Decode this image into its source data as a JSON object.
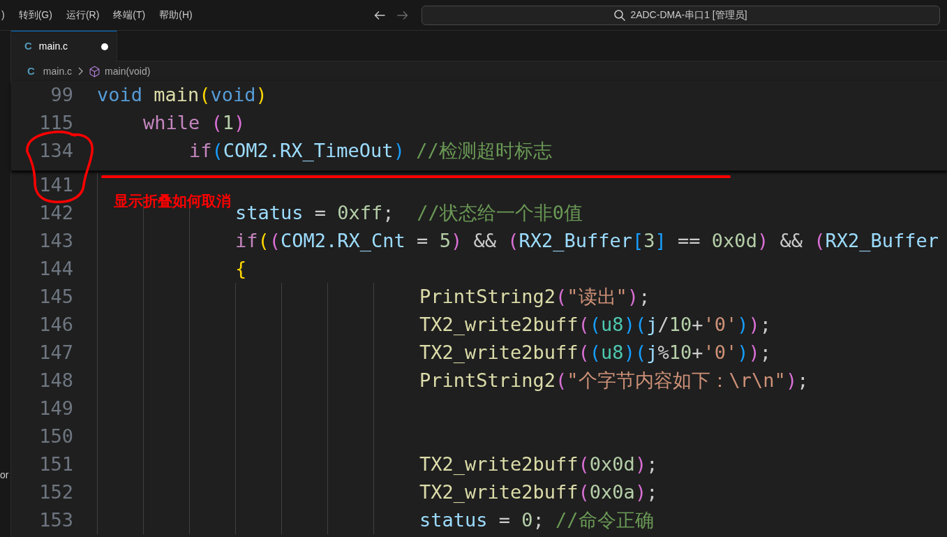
{
  "menu": [
    ")",
    "转到(G)",
    "运行(R)",
    "终端(T)",
    "帮助(H)"
  ],
  "nav": [
    {
      "kind": "back",
      "disabled": false
    },
    {
      "kind": "forward",
      "disabled": true
    }
  ],
  "command_center": {
    "title": "2ADC-DMA-串口1 [管理员]"
  },
  "sidebar": {
    "text": "or"
  },
  "tabs": [
    {
      "icon": "C",
      "label": "main.c",
      "selected": true,
      "modified": true
    }
  ],
  "breadcrumb": [
    {
      "kind": "file",
      "icon": "C",
      "label": "main.c"
    },
    {
      "kind": "symbol",
      "label": "main(void)"
    }
  ],
  "editor": {
    "sticky_scroll": [
      {
        "number": "99",
        "tokens": [
          {
            "text": "void",
            "kind": "keyword"
          },
          {
            "text": " main",
            "kind": "function"
          },
          {
            "text": "(",
            "kind": "bracket1"
          },
          {
            "text": "void",
            "kind": "keyword"
          },
          {
            "text": ")",
            "kind": "bracket1"
          }
        ]
      },
      {
        "number": "115",
        "tokens": [
          {
            "text": "while",
            "kind": "control"
          },
          {
            "text": " (",
            "kind": "bracket2"
          },
          {
            "text": "1",
            "kind": "number"
          },
          {
            "text": ")",
            "kind": "bracket2"
          }
        ]
      },
      {
        "number": "134",
        "tokens": [
          {
            "text": "if",
            "kind": "control"
          },
          {
            "text": "(",
            "kind": "bracket3"
          },
          {
            "text": "COM2.RX_TimeOut",
            "kind": "variable"
          },
          {
            "text": ")",
            "kind": "bracket3"
          },
          {
            "text": " //检测超时标志",
            "kind": "comment"
          }
        ]
      }
    ],
    "lines": [
      {
        "number": "141"
      },
      {
        "number": "142",
        "tokens": [
          {
            "text": "status",
            "kind": "variable"
          },
          {
            "text": " = ",
            "kind": "plain"
          },
          {
            "text": "0xff",
            "kind": "number"
          },
          {
            "text": ";",
            "kind": "plain"
          },
          {
            "text": "  //状态给一个非0值",
            "kind": "comment"
          }
        ]
      },
      {
        "number": "143",
        "tokens": [
          {
            "text": "if",
            "kind": "control"
          },
          {
            "text": "(",
            "kind": "bracket1"
          },
          {
            "text": "(",
            "kind": "bracket2"
          },
          {
            "text": "COM2.RX_Cnt",
            "kind": "variable"
          },
          {
            "text": " = ",
            "kind": "plain"
          },
          {
            "text": "5",
            "kind": "number"
          },
          {
            "text": ")",
            "kind": "bracket2"
          },
          {
            "text": " && ",
            "kind": "plain"
          },
          {
            "text": "(",
            "kind": "bracket2"
          },
          {
            "text": "RX2_Buffer",
            "kind": "variable"
          },
          {
            "text": "[",
            "kind": "bracket3"
          },
          {
            "text": "3",
            "kind": "number"
          },
          {
            "text": "]",
            "kind": "bracket3"
          },
          {
            "text": " == ",
            "kind": "plain"
          },
          {
            "text": "0x0d",
            "kind": "number"
          },
          {
            "text": ")",
            "kind": "bracket2"
          },
          {
            "text": " && ",
            "kind": "plain"
          },
          {
            "text": "(",
            "kind": "bracket2"
          },
          {
            "text": "RX2_Buffer",
            "kind": "variable"
          }
        ]
      },
      {
        "number": "144",
        "tokens": [
          {
            "text": "{",
            "kind": "bracket1"
          }
        ]
      },
      {
        "number": "145",
        "tokens": [
          {
            "text": "PrintString2",
            "kind": "function"
          },
          {
            "text": "(",
            "kind": "bracket2"
          },
          {
            "text": "\"读出\"",
            "kind": "string"
          },
          {
            "text": ")",
            "kind": "bracket2"
          },
          {
            "text": ";",
            "kind": "plain"
          }
        ]
      },
      {
        "number": "146",
        "tokens": [
          {
            "text": "TX2_write2buff",
            "kind": "function"
          },
          {
            "text": "(",
            "kind": "bracket2"
          },
          {
            "text": "(",
            "kind": "bracket3"
          },
          {
            "text": "u8",
            "kind": "type"
          },
          {
            "text": ")",
            "kind": "bracket3"
          },
          {
            "text": "(",
            "kind": "bracket3"
          },
          {
            "text": "j",
            "kind": "variable"
          },
          {
            "text": "/",
            "kind": "plain"
          },
          {
            "text": "10",
            "kind": "number"
          },
          {
            "text": "+",
            "kind": "plain"
          },
          {
            "text": "'0'",
            "kind": "string"
          },
          {
            "text": ")",
            "kind": "bracket3"
          },
          {
            "text": ")",
            "kind": "bracket2"
          },
          {
            "text": ";",
            "kind": "plain"
          }
        ]
      },
      {
        "number": "147",
        "tokens": [
          {
            "text": "TX2_write2buff",
            "kind": "function"
          },
          {
            "text": "(",
            "kind": "bracket2"
          },
          {
            "text": "(",
            "kind": "bracket3"
          },
          {
            "text": "u8",
            "kind": "type"
          },
          {
            "text": ")",
            "kind": "bracket3"
          },
          {
            "text": "(",
            "kind": "bracket3"
          },
          {
            "text": "j",
            "kind": "variable"
          },
          {
            "text": "%",
            "kind": "plain"
          },
          {
            "text": "10",
            "kind": "number"
          },
          {
            "text": "+",
            "kind": "plain"
          },
          {
            "text": "'0'",
            "kind": "string"
          },
          {
            "text": ")",
            "kind": "bracket3"
          },
          {
            "text": ")",
            "kind": "bracket2"
          },
          {
            "text": ";",
            "kind": "plain"
          }
        ]
      },
      {
        "number": "148",
        "tokens": [
          {
            "text": "PrintString2",
            "kind": "function"
          },
          {
            "text": "(",
            "kind": "bracket2"
          },
          {
            "text": "\"个字节内容如下：\\r\\n\"",
            "kind": "string"
          },
          {
            "text": ")",
            "kind": "bracket2"
          },
          {
            "text": ";",
            "kind": "plain"
          }
        ]
      },
      {
        "number": "149"
      },
      {
        "number": "150"
      },
      {
        "number": "151",
        "tokens": [
          {
            "text": "TX2_write2buff",
            "kind": "function"
          },
          {
            "text": "(",
            "kind": "bracket2"
          },
          {
            "text": "0x0d",
            "kind": "number"
          },
          {
            "text": ")",
            "kind": "bracket2"
          },
          {
            "text": ";",
            "kind": "plain"
          }
        ]
      },
      {
        "number": "152",
        "tokens": [
          {
            "text": "TX2_write2buff",
            "kind": "function"
          },
          {
            "text": "(",
            "kind": "bracket2"
          },
          {
            "text": "0x0a",
            "kind": "number"
          },
          {
            "text": ")",
            "kind": "bracket2"
          },
          {
            "text": ";",
            "kind": "plain"
          }
        ]
      },
      {
        "number": "153",
        "tokens": [
          {
            "text": "status",
            "kind": "variable"
          },
          {
            "text": " = ",
            "kind": "plain"
          },
          {
            "text": "0",
            "kind": "number"
          },
          {
            "text": ";",
            "kind": "plain"
          },
          {
            "text": " //命令正确",
            "kind": "comment"
          }
        ]
      }
    ]
  },
  "annotation": {
    "text": "显示折叠如何取消"
  }
}
